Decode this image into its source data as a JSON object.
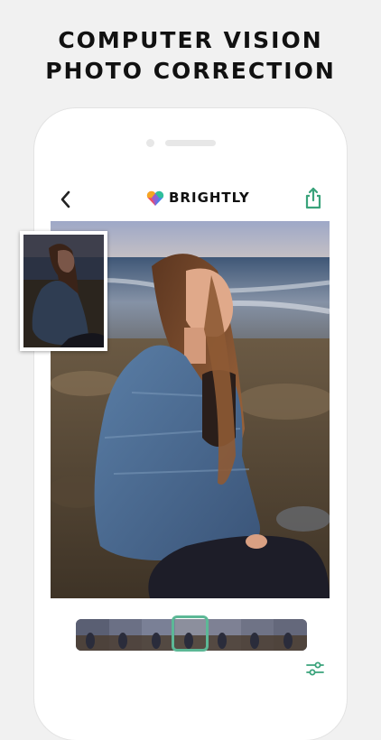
{
  "headline": {
    "line1": "COMPUTER VISION",
    "line2": "PHOTO CORRECTION"
  },
  "app": {
    "name": "BRIGHTLY",
    "logo_icon": "heart-logo-icon",
    "back_icon": "chevron-left-icon",
    "share_icon": "share-icon",
    "adjust_icon": "sliders-icon"
  },
  "colors": {
    "accent": "#5cb896",
    "background": "#f1f1f1",
    "phone": "#ffffff",
    "text": "#111111"
  },
  "filmstrip": {
    "frame_count": 7,
    "selected_index": 3
  }
}
